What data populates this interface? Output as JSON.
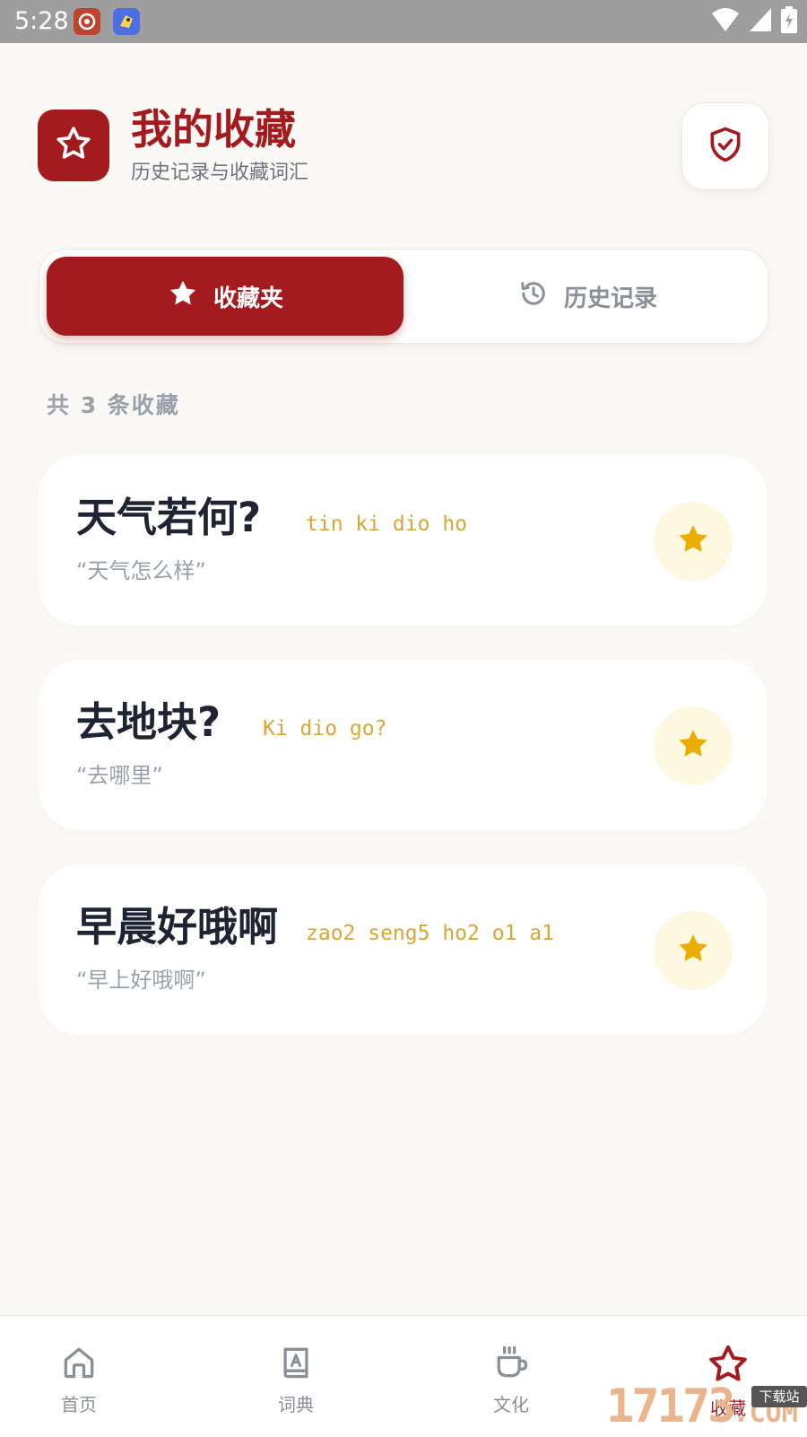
{
  "status_bar": {
    "time": "5:28"
  },
  "header": {
    "title": "我的收藏",
    "subtitle": "历史记录与收藏词汇",
    "app_icon": "star-icon",
    "action_icon": "shield-check-icon"
  },
  "tabs": [
    {
      "label": "收藏夹",
      "icon": "star-filled-icon",
      "active": true
    },
    {
      "label": "历史记录",
      "icon": "history-icon",
      "active": false
    }
  ],
  "count_text": "共 3 条收藏",
  "favorites": [
    {
      "word": "天气若何?",
      "pronunciation": "tin ki dio ho",
      "meaning": "“天气怎么样”"
    },
    {
      "word": "去地块?",
      "pronunciation": "Ki dio go?",
      "meaning": "“去哪里”"
    },
    {
      "word": "早晨好哦啊",
      "pronunciation": "zao2 seng5 ho2 o1 a1",
      "meaning": "“早上好哦啊”"
    }
  ],
  "nav": [
    {
      "label": "首页",
      "icon": "home-icon"
    },
    {
      "label": "词典",
      "icon": "book-icon"
    },
    {
      "label": "文化",
      "icon": "cup-icon"
    },
    {
      "label": "收藏",
      "icon": "star-icon",
      "active": true
    }
  ],
  "watermark": {
    "text": "17173",
    "badge": "下载站",
    "suffix": ".COM"
  },
  "colors": {
    "primary": "#A31B1E",
    "accent_gold": "#E9AE00",
    "pronunciation": "#D9A634",
    "muted": "#9AA0AA",
    "background": "#FBF9F5"
  }
}
